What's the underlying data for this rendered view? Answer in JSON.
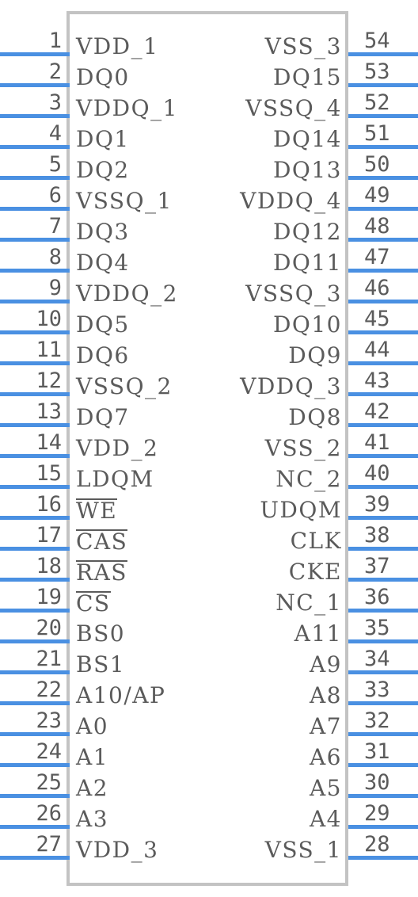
{
  "symbol": {
    "name": "sdram-54-pin-schematic-symbol",
    "total_pins": 54,
    "colors": {
      "pin_line": "#4a90e2",
      "text": "#5b5b5b",
      "body_border": "#c3c3c3",
      "background": "#ffffff"
    }
  },
  "left_pins": [
    {
      "number": "1",
      "name": "VDD_1",
      "overline": false
    },
    {
      "number": "2",
      "name": "DQ0",
      "overline": false
    },
    {
      "number": "3",
      "name": "VDDQ_1",
      "overline": false
    },
    {
      "number": "4",
      "name": "DQ1",
      "overline": false
    },
    {
      "number": "5",
      "name": "DQ2",
      "overline": false
    },
    {
      "number": "6",
      "name": "VSSQ_1",
      "overline": false
    },
    {
      "number": "7",
      "name": "DQ3",
      "overline": false
    },
    {
      "number": "8",
      "name": "DQ4",
      "overline": false
    },
    {
      "number": "9",
      "name": "VDDQ_2",
      "overline": false
    },
    {
      "number": "10",
      "name": "DQ5",
      "overline": false
    },
    {
      "number": "11",
      "name": "DQ6",
      "overline": false
    },
    {
      "number": "12",
      "name": "VSSQ_2",
      "overline": false
    },
    {
      "number": "13",
      "name": "DQ7",
      "overline": false
    },
    {
      "number": "14",
      "name": "VDD_2",
      "overline": false
    },
    {
      "number": "15",
      "name": "LDQM",
      "overline": false
    },
    {
      "number": "16",
      "name": "WE",
      "overline": true
    },
    {
      "number": "17",
      "name": "CAS",
      "overline": true
    },
    {
      "number": "18",
      "name": "RAS",
      "overline": true
    },
    {
      "number": "19",
      "name": "CS",
      "overline": true
    },
    {
      "number": "20",
      "name": "BS0",
      "overline": false
    },
    {
      "number": "21",
      "name": "BS1",
      "overline": false
    },
    {
      "number": "22",
      "name": "A10/AP",
      "overline": false
    },
    {
      "number": "23",
      "name": "A0",
      "overline": false
    },
    {
      "number": "24",
      "name": "A1",
      "overline": false
    },
    {
      "number": "25",
      "name": "A2",
      "overline": false
    },
    {
      "number": "26",
      "name": "A3",
      "overline": false
    },
    {
      "number": "27",
      "name": "VDD_3",
      "overline": false
    }
  ],
  "right_pins": [
    {
      "number": "54",
      "name": "VSS_3",
      "overline": false
    },
    {
      "number": "53",
      "name": "DQ15",
      "overline": false
    },
    {
      "number": "52",
      "name": "VSSQ_4",
      "overline": false
    },
    {
      "number": "51",
      "name": "DQ14",
      "overline": false
    },
    {
      "number": "50",
      "name": "DQ13",
      "overline": false
    },
    {
      "number": "49",
      "name": "VDDQ_4",
      "overline": false
    },
    {
      "number": "48",
      "name": "DQ12",
      "overline": false
    },
    {
      "number": "47",
      "name": "DQ11",
      "overline": false
    },
    {
      "number": "46",
      "name": "VSSQ_3",
      "overline": false
    },
    {
      "number": "45",
      "name": "DQ10",
      "overline": false
    },
    {
      "number": "44",
      "name": "DQ9",
      "overline": false
    },
    {
      "number": "43",
      "name": "VDDQ_3",
      "overline": false
    },
    {
      "number": "42",
      "name": "DQ8",
      "overline": false
    },
    {
      "number": "41",
      "name": "VSS_2",
      "overline": false
    },
    {
      "number": "40",
      "name": "NC_2",
      "overline": false
    },
    {
      "number": "39",
      "name": "UDQM",
      "overline": false
    },
    {
      "number": "38",
      "name": "CLK",
      "overline": false
    },
    {
      "number": "37",
      "name": "CKE",
      "overline": false
    },
    {
      "number": "36",
      "name": "NC_1",
      "overline": false
    },
    {
      "number": "35",
      "name": "A11",
      "overline": false
    },
    {
      "number": "34",
      "name": "A9",
      "overline": false
    },
    {
      "number": "33",
      "name": "A8",
      "overline": false
    },
    {
      "number": "32",
      "name": "A7",
      "overline": false
    },
    {
      "number": "31",
      "name": "A6",
      "overline": false
    },
    {
      "number": "30",
      "name": "A5",
      "overline": false
    },
    {
      "number": "29",
      "name": "A4",
      "overline": false
    },
    {
      "number": "28",
      "name": "VSS_1",
      "overline": false
    }
  ]
}
